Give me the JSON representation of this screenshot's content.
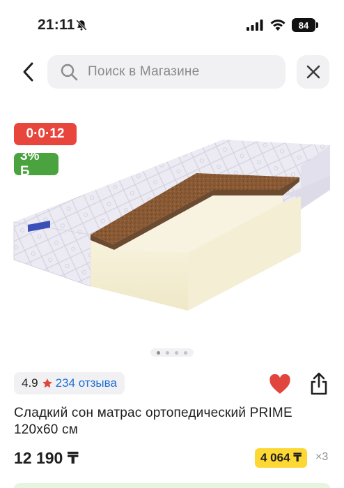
{
  "status_bar": {
    "time": "21:11",
    "battery": "84"
  },
  "search": {
    "placeholder": "Поиск в Магазине"
  },
  "badges": {
    "installment": "0·0·12",
    "bonus": "3% Б"
  },
  "gallery": {
    "slides": 4,
    "active_index": 0
  },
  "rating": {
    "value": "4.9",
    "reviews": "234 отзыва"
  },
  "product": {
    "title": "Сладкий сон матрас ортопедический PRIME 120x60 см",
    "price": "12 190 ₸",
    "installment_amount": "4 064 ₸",
    "installment_multiplier": "×3"
  },
  "icons": {
    "back": "chevron-left-icon",
    "search": "search-icon",
    "close": "close-icon",
    "heart": "heart-icon",
    "share": "share-icon",
    "star": "star-icon",
    "bell_off": "bell-off-icon",
    "signal": "signal-icon",
    "wifi": "wifi-icon",
    "battery": "battery-icon"
  },
  "colors": {
    "installment_badge": "#e8453c",
    "bonus_badge": "#4aa33f",
    "heart": "#e0453e",
    "star": "#e0453e",
    "reviews_link": "#1f6fd6",
    "installment_box": "#fdd835"
  }
}
